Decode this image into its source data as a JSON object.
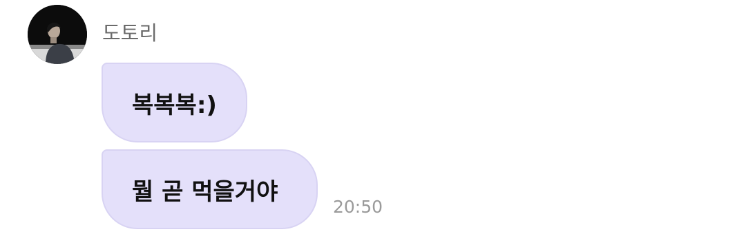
{
  "chat": {
    "sender": {
      "name": "도토리",
      "avatar": "profile-photo"
    },
    "messages": [
      {
        "text": "복복복:)"
      },
      {
        "text": "뭘 곧 먹을거야"
      }
    ],
    "timestamp": "20:50"
  },
  "colors": {
    "bubble_fill": "#e4e0fa",
    "bubble_border": "#d8d3f3",
    "name_text": "#6b6b6b",
    "message_text": "#111111",
    "timestamp_text": "#9a9a9a",
    "background": "#ffffff"
  }
}
